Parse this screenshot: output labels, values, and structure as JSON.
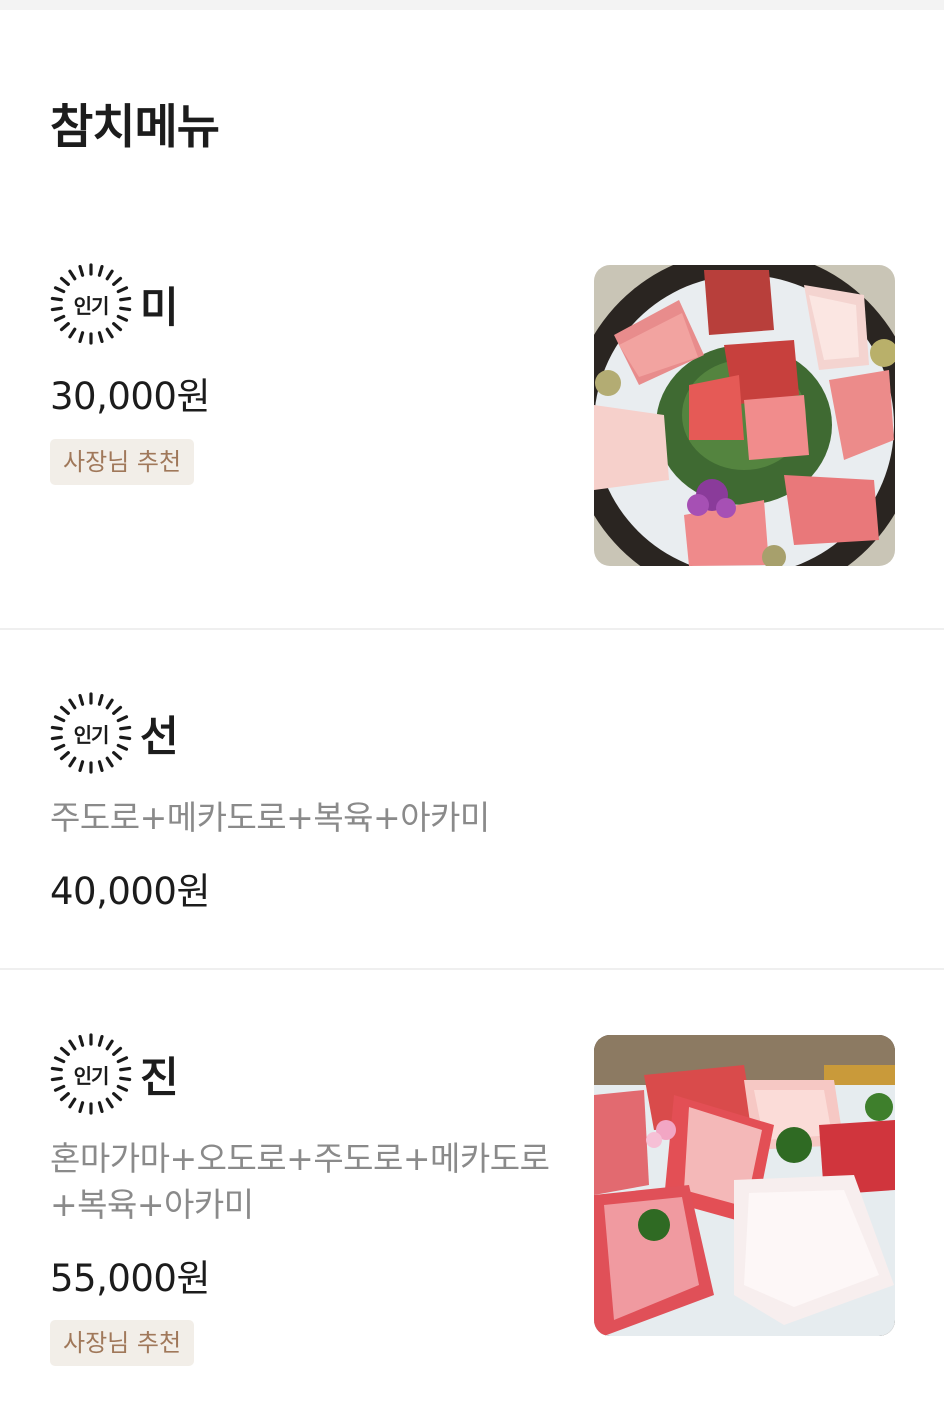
{
  "page": {
    "title": "참치메뉴"
  },
  "items": [
    {
      "badge": "인기",
      "name": "미",
      "description": "",
      "price": "30,000원",
      "tag": "사장님 추천",
      "image_alt": "tuna sashimi platter"
    },
    {
      "badge": "인기",
      "name": "선",
      "description": "주도로+메카도로+복육+아카미",
      "price": "40,000원",
      "tag": ""
    },
    {
      "badge": "인기",
      "name": "진",
      "description_line1": "혼마가마+오도로+주도로+메카도로",
      "description_line2": "+복육+아카미",
      "price": "55,000원",
      "tag": "사장님 추천",
      "image_alt": "premium tuna sashimi platter"
    }
  ],
  "colors": {
    "tag_bg": "#f2eee8",
    "tag_text": "#a0785a",
    "desc_text": "#8a8a8a",
    "divider": "#efefef"
  }
}
